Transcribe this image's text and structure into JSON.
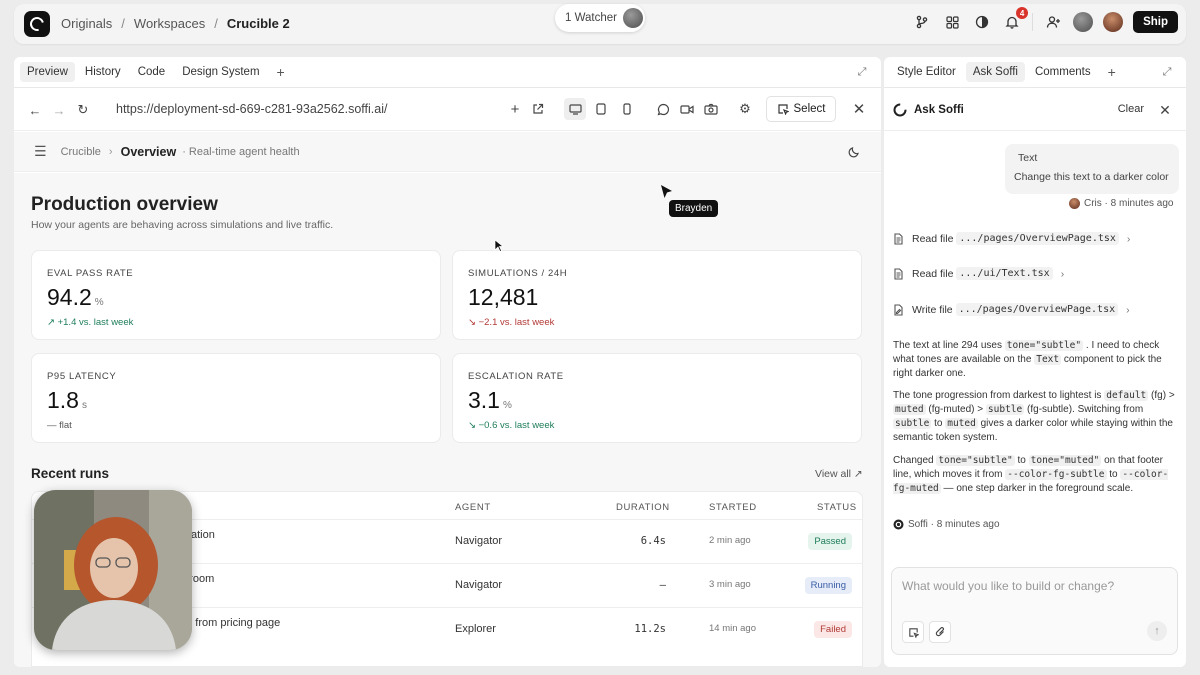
{
  "topbar": {
    "breadcrumb": [
      "Originals",
      "Workspaces",
      "Crucible 2"
    ],
    "watcher_label": "1 Watcher",
    "notif_count": "4",
    "ship_label": "Ship"
  },
  "left_tabs": [
    "Preview",
    "History",
    "Code",
    "Design System"
  ],
  "urlbar": {
    "url": "https://deployment-sd-669-c281-93a2562.soffi.ai/",
    "select_label": "Select"
  },
  "app_header": {
    "crumb": "Crucible",
    "current": "Overview",
    "subtitle": "· Real-time agent health"
  },
  "page": {
    "title": "Production overview",
    "subtitle": "How your agents are behaving across simulations and live traffic."
  },
  "metrics": [
    {
      "label": "EVAL PASS RATE",
      "value": "94.2",
      "unit": "%",
      "delta": "↗ +1.4 vs. last week",
      "trend": "up"
    },
    {
      "label": "SIMULATIONS / 24H",
      "value": "12,481",
      "unit": "",
      "delta": "↘ −2.1 vs. last week",
      "trend": "dn"
    },
    {
      "label": "P95 LATENCY",
      "value": "1.8",
      "unit": "s",
      "delta": "— flat",
      "trend": "flat"
    },
    {
      "label": "ESCALATION RATE",
      "value": "3.1",
      "unit": "%",
      "delta": "↘ −0.6 vs. last week",
      "trend": "up"
    }
  ],
  "recent": {
    "title": "Recent runs",
    "view_all": "View all ↗",
    "headers": {
      "agent": "AGENT",
      "duration": "DURATION",
      "started": "STARTED",
      "status": "STATUS"
    },
    "rows": [
      {
        "name": "ellation",
        "agent": "Navigator",
        "duration": "6.4s",
        "started": "2 min ago",
        "status": "Passed",
        "cls": "passed"
      },
      {
        "name": "d room",
        "agent": "Navigator",
        "duration": "—",
        "started": "3 min ago",
        "status": "Running",
        "cls": "running"
      },
      {
        "name": "nd from pricing page",
        "agent": "Explorer",
        "duration": "11.2s",
        "started": "14 min ago",
        "status": "Failed",
        "cls": "failed"
      }
    ]
  },
  "cursor": {
    "name": "Brayden"
  },
  "right_tabs": [
    "Style Editor",
    "Ask Soffi",
    "Comments"
  ],
  "chat": {
    "title": "Ask Soffi",
    "clear": "Clear",
    "user_msg_title": "Text",
    "user_msg": "Change this text to a darker color",
    "user_meta": "Cris · 8 minutes ago",
    "tools": [
      {
        "verb": "Read file",
        "path": ".../pages/OverviewPage.tsx"
      },
      {
        "verb": "Read file",
        "path": ".../ui/Text.tsx"
      },
      {
        "verb": "Write file",
        "path": ".../pages/OverviewPage.tsx"
      }
    ],
    "p1_a": "The text at line 294 uses",
    "p1_code1": "tone=\"subtle\"",
    "p1_b": ". I need to check what tones are available on the",
    "p1_code2": "Text",
    "p1_c": "component to pick the right darker one.",
    "p2_a": "The tone progression from darkest to lightest is",
    "p2_code1": "default",
    "p2_b": "(fg) >",
    "p2_code2": "muted",
    "p2_c": "(fg-muted) >",
    "p2_code3": "subtle",
    "p2_d": "(fg-subtle). Switching from",
    "p2_code4": "subtle",
    "p2_e": "to",
    "p2_code5": "muted",
    "p2_f": "gives a darker color while staying within the semantic token system.",
    "p3_a": "Changed",
    "p3_code1": "tone=\"subtle\"",
    "p3_b": "to",
    "p3_code2": "tone=\"muted\"",
    "p3_c": "on that footer line, which moves it from",
    "p3_code3": "--color-fg-subtle",
    "p3_d": "to",
    "p3_code4": "--color-fg-muted",
    "p3_e": "— one step darker in the foreground scale.",
    "assistant_meta": "Soffi · 8 minutes ago",
    "input_placeholder": "What would you like to build or change?"
  }
}
